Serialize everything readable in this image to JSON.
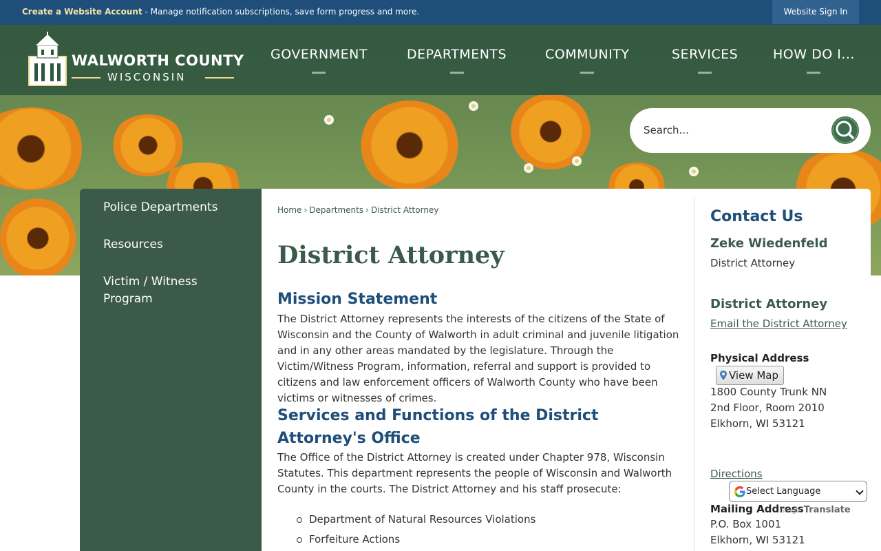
{
  "topbar": {
    "account_link": "Create a Website Account",
    "account_desc": " - Manage notification subscriptions, save form progress and more.",
    "signin": "Website Sign In"
  },
  "logo": {
    "name": "WALWORTH COUNTY",
    "state": "WISCONSIN"
  },
  "nav": {
    "items": [
      {
        "label": "GOVERNMENT"
      },
      {
        "label": "DEPARTMENTS"
      },
      {
        "label": "COMMUNITY"
      },
      {
        "label": "SERVICES"
      },
      {
        "label": "HOW DO I..."
      }
    ]
  },
  "search": {
    "placeholder": "Search...",
    "icon": "search-icon"
  },
  "sidebar": {
    "items": [
      {
        "label": "Police Departments"
      },
      {
        "label": "Resources"
      },
      {
        "label": "Victim / Witness Program"
      }
    ]
  },
  "breadcrumb": {
    "home": "Home",
    "departments": "Departments",
    "current": "District Attorney",
    "separator": "›"
  },
  "main": {
    "title": "District Attorney",
    "mission_heading": "Mission Statement",
    "mission_text": "The District Attorney represents the interests of the citizens of the State of Wisconsin and the County of Walworth in adult criminal and juvenile litigation and in any other areas mandated by the legislature. Through the Victim/Witness Program, information, referral and support is provided to citizens and law enforcement officers of Walworth County who have been victims or witnesses of crimes.",
    "services_heading": "Services and Functions of the District Attorney's Office",
    "services_text": "The Office of the District Attorney is created under Chapter 978, Wisconsin Statutes. This department represents the people of Wisconsin and Walworth County in the courts. The District Attorney and his staff prosecute:",
    "bullets": [
      "Department of Natural Resources Violations",
      "Forfeiture Actions"
    ]
  },
  "contact": {
    "heading": "Contact Us",
    "person_name": "Zeke Wiedenfeld",
    "person_title": "District Attorney",
    "dept_heading": "District Attorney",
    "email_link": "Email the District Attorney",
    "physical_label": "Physical Address",
    "view_map": "View Map",
    "address_line1": "1800 County Trunk NN",
    "address_line2": "2nd Floor, Room 2010",
    "address_line3": "Elkhorn, WI 53121",
    "directions": "Directions",
    "mailing_label": "Mailing Address",
    "mailing_line1": "P.O. Box 1001",
    "mailing_line2": "Elkhorn, WI 53121"
  },
  "translate": {
    "select_label": "Select Language",
    "google_label": "Google",
    "translate_label": "Translate"
  },
  "colors": {
    "topbar": "#1e4e79",
    "header": "#31563f",
    "sidebar": "#3b5a4a",
    "heading_blue": "#1e4e79",
    "heading_green": "#3b5a4a"
  }
}
